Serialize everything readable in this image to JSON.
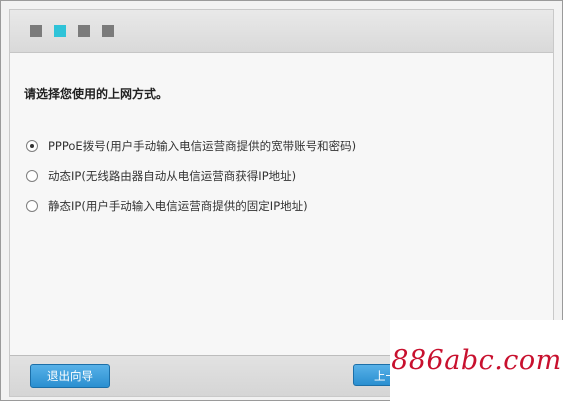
{
  "wizard": {
    "steps": [
      {
        "state": "done",
        "color": "#7b7b7b"
      },
      {
        "state": "active",
        "color": "#2fc3d8"
      },
      {
        "state": "pending",
        "color": "#7b7b7b"
      },
      {
        "state": "pending",
        "color": "#7b7b7b"
      }
    ],
    "prompt": "请选择您使用的上网方式。",
    "options": [
      {
        "label": "PPPoE拨号(用户手动输入电信运营商提供的宽带账号和密码)",
        "selected": true
      },
      {
        "label": "动态IP(无线路由器自动从电信运营商获得IP地址)",
        "selected": false
      },
      {
        "label": "静态IP(用户手动输入电信运营商提供的固定IP地址)",
        "selected": false
      }
    ],
    "buttons": {
      "exit_label": "退出向导",
      "prev_label": "上一"
    }
  },
  "watermark": {
    "text": "886abc.com",
    "color": "#c8102e"
  }
}
